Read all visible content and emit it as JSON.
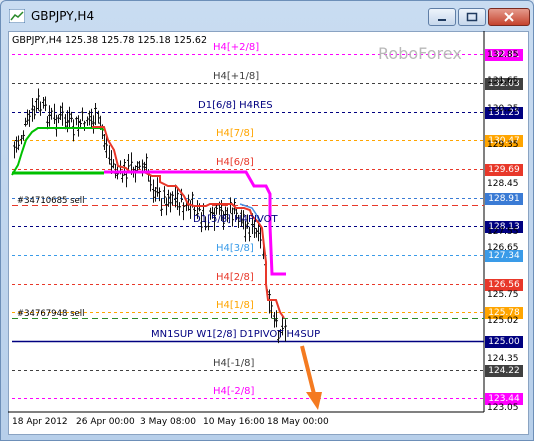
{
  "window": {
    "title": "GBPJPY,H4",
    "minimize_icon": "minimize-icon",
    "maximize_icon": "maximize-icon",
    "close_icon": "close-icon"
  },
  "chart": {
    "symbol_info": "GBPJPY,H4  125.38 125.78 125.18 125.62",
    "watermark": "RoboForex",
    "colors": {
      "magenta": "#ff00ff",
      "orange": "#ffa500",
      "red": "#e8382a",
      "navy": "#000080",
      "blue": "#3a7bd5",
      "green": "#00c000",
      "dark": "#3a3a3a",
      "arrow": "#f47a20"
    }
  },
  "levels": [
    {
      "label": "H4[+2/8]",
      "price": "132.81",
      "color": "#ff00ff"
    },
    {
      "label": "H4[+1/8]",
      "price": "132.03",
      "color": "#404040"
    },
    {
      "label": "D1[6/8] H4RES",
      "price": "131.25",
      "color": "#000080"
    },
    {
      "label": "H4[7/8]",
      "price": "130.47",
      "color": "#ffa500"
    },
    {
      "label": "H4[6/8]",
      "price": "129.69",
      "color": "#e8382a"
    },
    {
      "label": "",
      "price": "128.91",
      "color": "#3a7bd5"
    },
    {
      "label": "D1[5/8] H4PIVOT",
      "price": "128.13",
      "color": "#000080"
    },
    {
      "label": "H4[3/8]",
      "price": "127.34",
      "color": "#3a9be8"
    },
    {
      "label": "H4[2/8]",
      "price": "126.56",
      "color": "#e8382a"
    },
    {
      "label": "H4[1/8]",
      "price": "125.78",
      "color": "#ffa500"
    },
    {
      "label": "MN1SUP W1[2/8] D1PIVOT H4SUP",
      "price": "125.00",
      "color": "#000080"
    },
    {
      "label": "H4[-1/8]",
      "price": "124.22",
      "color": "#404040"
    },
    {
      "label": "H4[-2/8]",
      "price": "123.44",
      "color": "#ff00ff"
    }
  ],
  "orders": [
    {
      "label": "#34710685 sell"
    },
    {
      "label": "#34767948 sell"
    }
  ],
  "price_axis": [
    "132.85",
    "131.65",
    "130.25",
    "129.35",
    "128.45",
    "127.55",
    "126.65",
    "125.75",
    "125.02",
    "124.35",
    "123.05"
  ],
  "time_axis": [
    "18 Apr 2012",
    "26 Apr 00:00",
    "3 May 08:00",
    "10 May 16:00",
    "18 May 00:00"
  ]
}
